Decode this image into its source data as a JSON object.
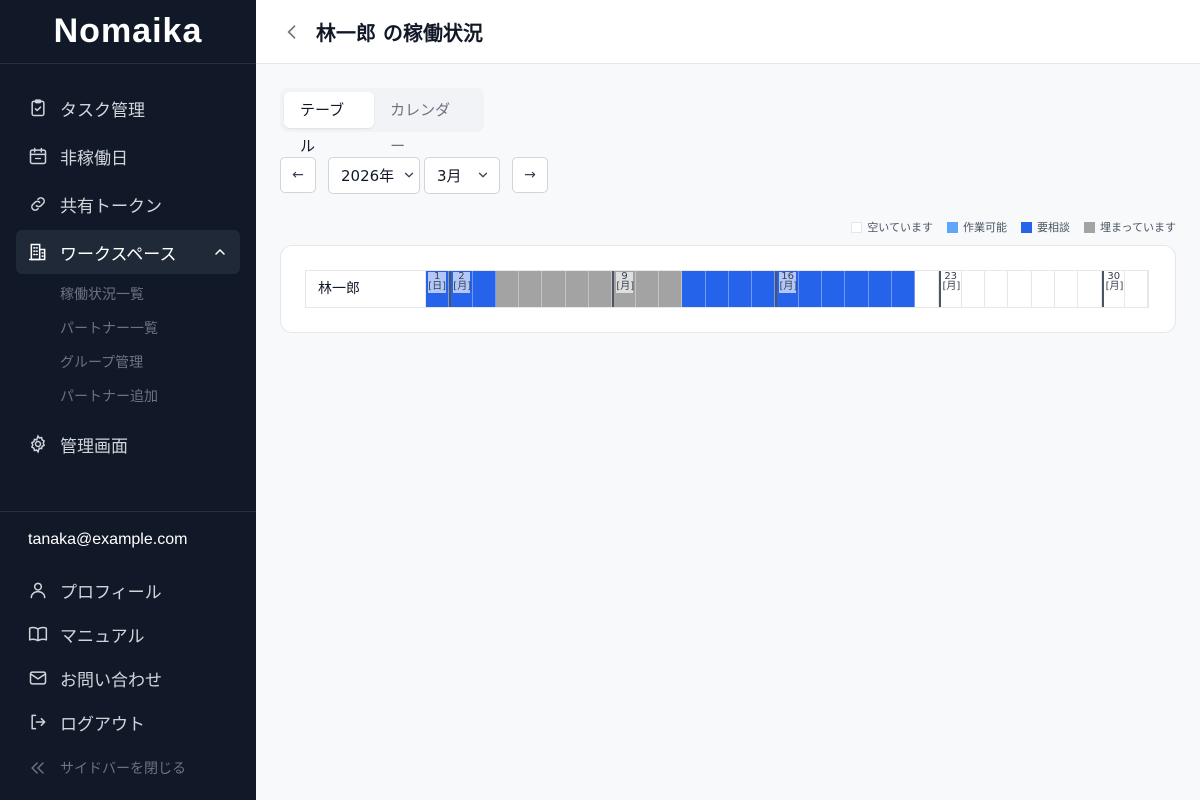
{
  "app": {
    "logo": "Nomaika"
  },
  "sidebar": {
    "items": [
      {
        "label": "タスク管理",
        "icon": "clipboard-check-icon"
      },
      {
        "label": "非稼働日",
        "icon": "calendar-icon"
      },
      {
        "label": "共有トークン",
        "icon": "link-icon"
      },
      {
        "label": "ワークスペース",
        "icon": "building-icon"
      },
      {
        "label": "管理画面",
        "icon": "gear-icon"
      }
    ],
    "workspace_sub": [
      {
        "label": "稼働状況一覧"
      },
      {
        "label": "パートナー一覧"
      },
      {
        "label": "グループ管理"
      },
      {
        "label": "パートナー追加"
      }
    ],
    "user_email": "tanaka@example.com",
    "bottom": [
      {
        "label": "プロフィール",
        "icon": "user-icon"
      },
      {
        "label": "マニュアル",
        "icon": "book-icon"
      },
      {
        "label": "お問い合わせ",
        "icon": "mail-icon"
      },
      {
        "label": "ログアウト",
        "icon": "logout-icon"
      }
    ],
    "collapse_label": "サイドバーを閉じる"
  },
  "header": {
    "title": "林一郎 の稼働状況"
  },
  "tabs": [
    {
      "label": "テーブル"
    },
    {
      "label": "カレンダー"
    }
  ],
  "controls": {
    "prev": "←",
    "next": "→",
    "year": "2026年",
    "month": "3月"
  },
  "legend": [
    {
      "label": "空いています",
      "color": "#ffffff"
    },
    {
      "label": "作業可能",
      "color": "#60a5fa"
    },
    {
      "label": "要相談",
      "color": "#2563eb"
    },
    {
      "label": "埋まっています",
      "color": "#a3a3a3"
    }
  ],
  "status_colors": {
    "free": "#ffffff",
    "available": "#60a5fa",
    "consult": "#2563eb",
    "busy": "#a3a3a3"
  },
  "schedule": {
    "person": "林一郎",
    "days": [
      {
        "day": "1",
        "dow": "[日]",
        "status": "consult"
      },
      {
        "day": "2",
        "dow": "[月]",
        "status": "consult",
        "week_start": true
      },
      {
        "status": "consult"
      },
      {
        "status": "busy"
      },
      {
        "status": "busy"
      },
      {
        "status": "busy"
      },
      {
        "status": "busy"
      },
      {
        "status": "busy"
      },
      {
        "day": "9",
        "dow": "[月]",
        "status": "busy",
        "week_start": true
      },
      {
        "status": "busy"
      },
      {
        "status": "busy"
      },
      {
        "status": "consult"
      },
      {
        "status": "consult"
      },
      {
        "status": "consult"
      },
      {
        "status": "consult"
      },
      {
        "day": "16",
        "dow": "[月]",
        "status": "consult",
        "week_start": true
      },
      {
        "status": "consult"
      },
      {
        "status": "consult"
      },
      {
        "status": "consult"
      },
      {
        "status": "consult"
      },
      {
        "status": "consult"
      },
      {
        "status": "free"
      },
      {
        "day": "23",
        "dow": "[月]",
        "status": "free",
        "week_start": true
      },
      {
        "status": "free"
      },
      {
        "status": "free"
      },
      {
        "status": "free"
      },
      {
        "status": "free"
      },
      {
        "status": "free"
      },
      {
        "status": "free"
      },
      {
        "day": "30",
        "dow": "[月]",
        "status": "free",
        "week_start": true
      },
      {
        "status": "free"
      }
    ]
  }
}
